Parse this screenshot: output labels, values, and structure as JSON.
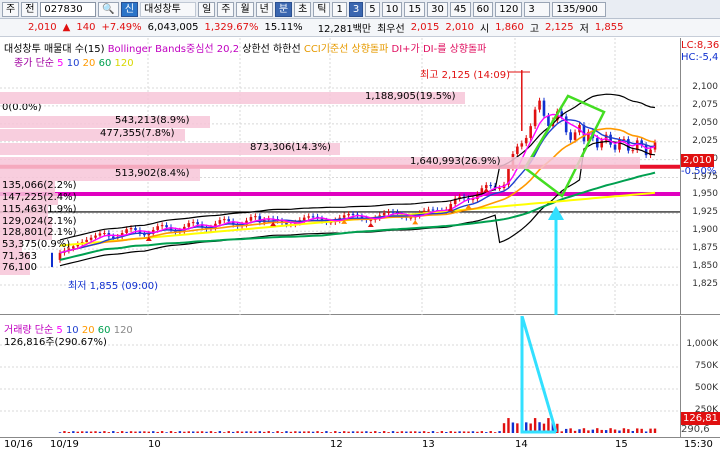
{
  "toolbar1": {
    "dropdown": "주",
    "combo": "전",
    "code": "027830",
    "search_icon": "search-icon",
    "badge": "신",
    "stock_name": "대성창투",
    "periods": [
      "일",
      "주",
      "월",
      "년",
      "분",
      "초",
      "틱",
      "1",
      "3",
      "5",
      "10",
      "15",
      "30",
      "45",
      "60",
      "120"
    ],
    "selected_period": "3",
    "right_combo": "3",
    "count": "135/900"
  },
  "toolbar2": {
    "price": "2,010",
    "change": "140",
    "change_pct": "+7.49%",
    "volume": "6,043,005",
    "vol_ratio": "1,329.67%",
    "turnover": "15.11%",
    "amount": "12,281백만",
    "best_ask_label": "최우선",
    "best_ask": "2,015",
    "best_bid": "2,010",
    "open_label": "시",
    "open": "1,860",
    "high_label": "고",
    "high": "2,125",
    "low_label": "저",
    "low": "1,855"
  },
  "legend": {
    "name": "대성창투 매물대 수(15)",
    "bb": "Bollinger Bands중심선 20,2",
    "upper": "상한선",
    "lower": "하한선",
    "cci": "CCI기준선 상향돌파",
    "dmi": "DI+가 DI-를 상향돌파",
    "ma_title": "종가 단순",
    "ma": [
      "5",
      "10",
      "20",
      "60",
      "120"
    ],
    "right_lc": "LC:8,36",
    "right_hc": "HC:-5,4"
  },
  "annotations": {
    "high": "최고 2,125 (14:09)",
    "low": "최저 1,855 (09:00)"
  },
  "volume_profile": [
    {
      "label": "0(0.0%)",
      "value": 0
    },
    {
      "label": "1,188,905(19.5%)",
      "value": 19.5
    },
    {
      "label": "543,213(8.9%)",
      "value": 8.9
    },
    {
      "label": "477,355(7.8%)",
      "value": 7.8
    },
    {
      "label": "873,306(14.3%)",
      "value": 14.3
    },
    {
      "label": "1,640,993(26.9%)",
      "value": 26.9
    },
    {
      "label": "513,902(8.4%)",
      "value": 8.4
    },
    {
      "label": "135,066(2.2%)",
      "value": 2.2
    },
    {
      "label": "147,225(2.4%)",
      "value": 2.4
    },
    {
      "label": "115,463(1.9%)",
      "value": 1.9
    },
    {
      "label": "129,024(2.1%)",
      "value": 2.1
    },
    {
      "label": "128,801(2.1%)",
      "value": 2.1
    },
    {
      "label": "53,375(0.9%)",
      "value": 0.9
    },
    {
      "label": "71,363",
      "value": 1.2
    },
    {
      "label": "76,100",
      "value": 1.2
    }
  ],
  "price_axis": [
    "2,100",
    "2,075",
    "2,050",
    "2,025",
    "2,000",
    "1,975",
    "1,950",
    "1,925",
    "1,900",
    "1,875",
    "1,850",
    "1,825"
  ],
  "current_price_tag": "2,010",
  "current_change_tag": "-0.50%",
  "volume_pane": {
    "title": "거래량 단순",
    "ma": [
      "5",
      "10",
      "20",
      "60",
      "120"
    ],
    "value": "126,816주(290.67%)",
    "axis": [
      "1,000K",
      "750K",
      "500K",
      "250K"
    ],
    "tag1": "126,81",
    "tag2": "290,6"
  },
  "dates": [
    "10/16",
    "10/19",
    "10",
    "12",
    "13",
    "14",
    "15",
    "15:30"
  ],
  "colors": {
    "up": "#e01010",
    "down": "#1030d0",
    "ma5": "#ff00ff",
    "ma10": "#1f3fd0",
    "ma20": "#ff9900",
    "ma60": "#00a050",
    "ma120": "#ffff00",
    "support_red": "#e8102a",
    "support_magenta": "#e000c0",
    "cyan_annotation": "#33e0ff",
    "green_box": "#44dd22"
  }
}
